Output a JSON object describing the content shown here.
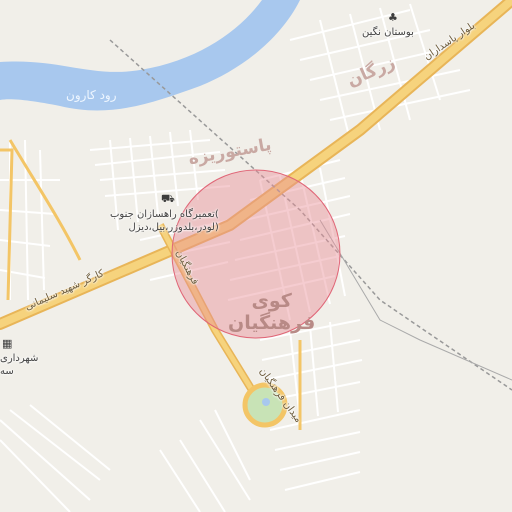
{
  "map": {
    "river_label": "رود کارون",
    "highway_label_sw": "کارگر شهید سلیمانی",
    "highway_label_ne": "بلوار پاسداران",
    "road_label_diag": "فرهنگیان",
    "road_label_circle": "میدان فرهنگیان",
    "area_pastorizeh": "پاستوریزه",
    "area_zargan": "زرگان",
    "area_kooy": "کوی",
    "area_farhangian": "فرهنگیان",
    "park_label": "بوستان نگین",
    "poi_repair_line1": "تعمیرگاه راهسازان جنوب(",
    "poi_repair_line2": "لودر،بلدوزر،بیل،دیزل)",
    "poi_municipality_line1": "شهرداری",
    "poi_municipality_line2": "سه",
    "icons": {
      "car_repair": "car-icon",
      "park": "tree-icon",
      "municipality": "building-icon"
    },
    "colors": {
      "background": "#f1efe9",
      "river": "#a8c8ee",
      "highway": "#f3c566",
      "street": "#ffffff",
      "highlight_circle": "#e98e97",
      "roundabout_park": "#c8e3b6"
    }
  }
}
